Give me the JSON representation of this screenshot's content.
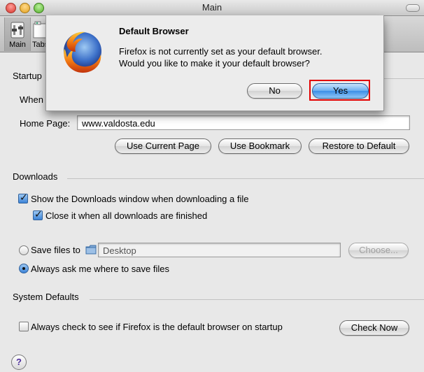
{
  "window": {
    "title": "Main"
  },
  "toolbar": {
    "items": [
      {
        "label": "Main",
        "icon": "main-switch-icon"
      },
      {
        "label": "Tabs",
        "icon": "tabs-icon"
      }
    ]
  },
  "startup": {
    "label": "Startup",
    "when_label": "When",
    "home_page_label": "Home Page:",
    "home_page_value": "www.valdosta.edu",
    "buttons": {
      "use_current": "Use Current Page",
      "use_bookmark": "Use Bookmark",
      "restore_default": "Restore to Default"
    }
  },
  "downloads": {
    "label": "Downloads",
    "show_window_label": "Show the Downloads window when downloading a file",
    "show_window_checked": true,
    "close_when_done_label": "Close it when all downloads are finished",
    "close_when_done_checked": true,
    "save_files_label": "Save files to",
    "save_location": "Desktop",
    "choose_button": "Choose...",
    "always_ask_label": "Always ask me where to save files",
    "selected_option": "always_ask"
  },
  "system_defaults": {
    "label": "System Defaults",
    "always_check_label": "Always check to see if Firefox is the default browser on startup",
    "always_check_checked": false,
    "check_now_button": "Check Now"
  },
  "help": {
    "label": "?"
  },
  "dialog": {
    "title": "Default Browser",
    "message_line1": "Firefox is not currently set as your default browser.",
    "message_line2": "Would you like to make it your default browser?",
    "no_button": "No",
    "yes_button": "Yes",
    "icon": "firefox-logo-icon"
  }
}
